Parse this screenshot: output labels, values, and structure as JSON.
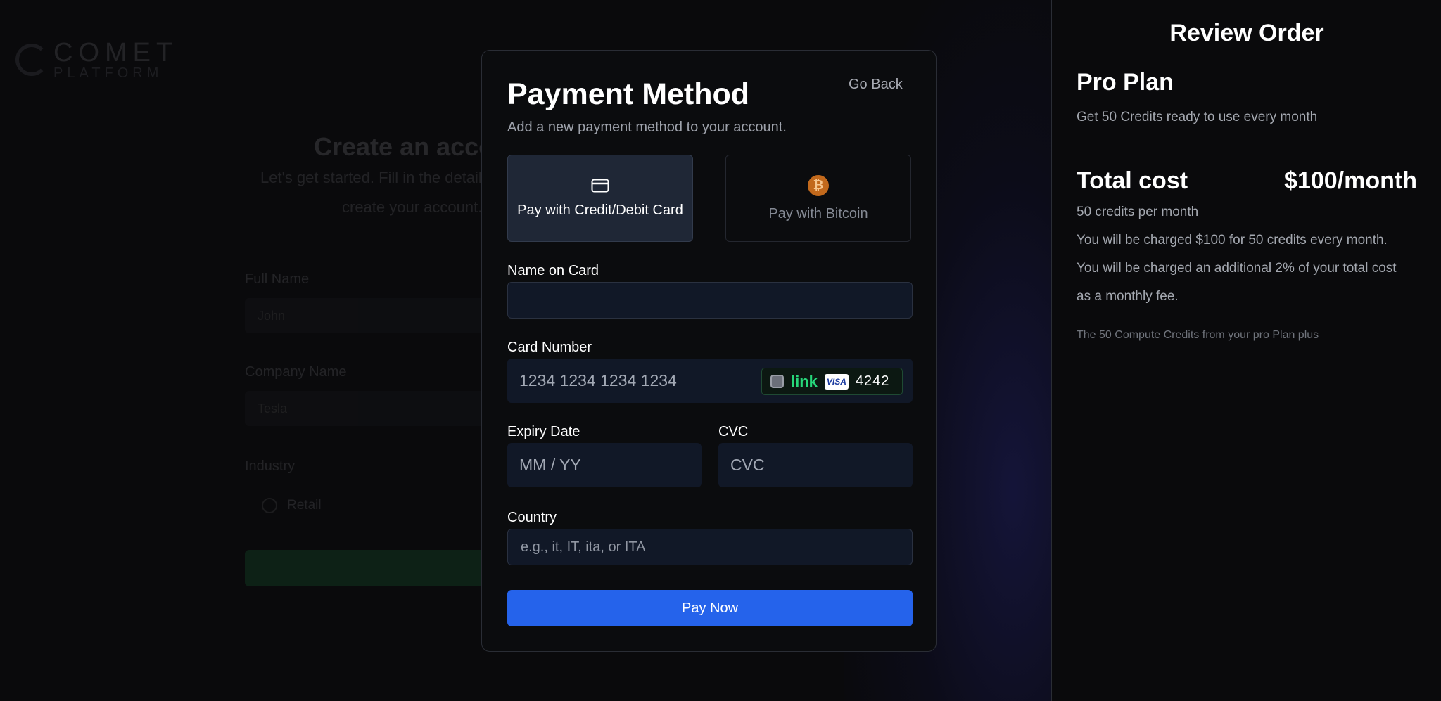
{
  "background": {
    "logo": {
      "name": "COMET",
      "sub": "PLATFORM"
    },
    "title": "Create an account",
    "subtitle_line1": "Let's get started. Fill in the details below to",
    "subtitle_line2": "create your account.",
    "fields": [
      {
        "label": "Full Name",
        "value": "John"
      },
      {
        "label": "Company Name",
        "value": "Tesla"
      }
    ],
    "radio_group_label": "Industry",
    "radio_option": "Retail"
  },
  "modal": {
    "title": "Payment Method",
    "go_back": "Go Back",
    "subtitle": "Add a new payment method to your account.",
    "payment_options": [
      {
        "label": "Pay with Credit/Debit Card",
        "icon": "credit-card-icon",
        "selected": true
      },
      {
        "label": "Pay with Bitcoin",
        "icon": "bitcoin-icon",
        "selected": false
      }
    ],
    "name_label": "Name on Card",
    "name_value": "",
    "card_label": "Card Number",
    "card_placeholder": "1234 1234 1234 1234",
    "link": {
      "word": "link",
      "brand": "VISA",
      "last4": "4242"
    },
    "expiry_label": "Expiry Date",
    "expiry_placeholder": "MM / YY",
    "cvc_label": "CVC",
    "cvc_placeholder": "CVC",
    "country_label": "Country",
    "country_placeholder": "e.g., it, IT, ita, or ITA",
    "pay_button": "Pay Now"
  },
  "review": {
    "title": "Review Order",
    "plan_name": "Pro Plan",
    "plan_description": "Get 50 Credits ready to use every month",
    "total_label": "Total cost",
    "total_value": "$100/month",
    "credits_line": "50 credits per month",
    "charge_line": "You will be charged $100 for 50 credits every month.",
    "fee_line1": "You will be charged an additional 2% of your total cost",
    "fee_line2": "as a monthly fee.",
    "note": "The 50 Compute Credits from your pro Plan plus"
  },
  "colors": {
    "accent": "#2563eb",
    "link_green": "#27d77a",
    "bitcoin_orange": "#c2691c",
    "selected_option_bg": "#1f2736"
  }
}
